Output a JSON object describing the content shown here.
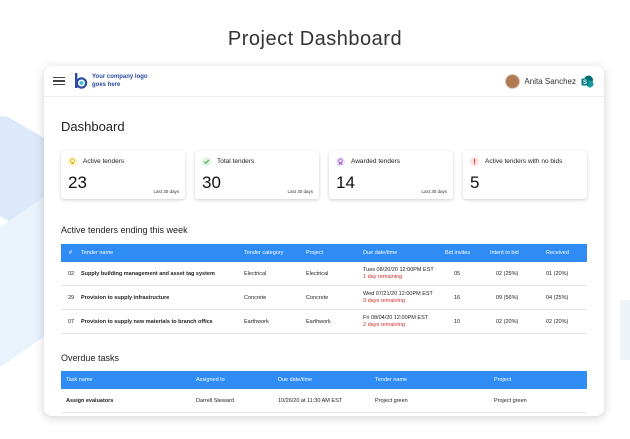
{
  "page_heading": "Project Dashboard",
  "header": {
    "logo_line1": "Your company logo",
    "logo_line2": "goes here",
    "user_name": "Anita Sanchez"
  },
  "dashboard": {
    "title": "Dashboard",
    "cards": [
      {
        "label": "Active tenders",
        "value": "23",
        "sub": "Last 30 days",
        "icon": "lightbulb-icon"
      },
      {
        "label": "Total tenders",
        "value": "30",
        "sub": "Last 30 days",
        "icon": "check-icon"
      },
      {
        "label": "Awarded tenders",
        "value": "14",
        "sub": "Last 30 days",
        "icon": "award-icon"
      },
      {
        "label": "Active tenders with no bids",
        "value": "5",
        "sub": "",
        "icon": "alert-icon"
      }
    ]
  },
  "active_tenders": {
    "title": "Active tenders ending this week",
    "columns": [
      "#",
      "Tender name",
      "Tender category",
      "Project",
      "Due date/time",
      "Bid invites",
      "Intent to bid",
      "Received"
    ],
    "rows": [
      {
        "num": "02",
        "name": "Supply building management and asset tag system",
        "category": "Electrical",
        "project": "Electrical",
        "due": "Tues 08/20/20 12:00PM EST",
        "remaining": "1 day remaining",
        "invites": "05",
        "intent": "02 (25%)",
        "received": "01 (20%)"
      },
      {
        "num": "29",
        "name": "Provision to supply infrastructure",
        "category": "Concrete",
        "project": "Concrete",
        "due": "Wed 07/21/20 12:00PM EST",
        "remaining": "3 days remaining",
        "invites": "16",
        "intent": "09 (56%)",
        "received": "04 (25%)"
      },
      {
        "num": "07",
        "name": "Provision to supply new materials to branch office",
        "category": "Earthwork",
        "project": "Earthwork",
        "due": "Fri 08/04/20 12:00PM EST",
        "remaining": "2 days remaining",
        "invites": "10",
        "intent": "02 (20%)",
        "received": "02 (20%)"
      }
    ]
  },
  "overdue": {
    "title": "Overdue tasks",
    "columns": [
      "Task name",
      "Assigned to",
      "Due date/time",
      "Tender name",
      "Project"
    ],
    "rows": [
      {
        "task": "Assign evaluators",
        "assigned": "Darrell Steward",
        "due": "10/26/20 at 11:30 AM EST",
        "tender": "Project green",
        "project": "Project green"
      }
    ]
  },
  "colors": {
    "accent": "#2f8cf5",
    "overdue_text": "#d12c2c",
    "logo": "#2c4aa0"
  }
}
